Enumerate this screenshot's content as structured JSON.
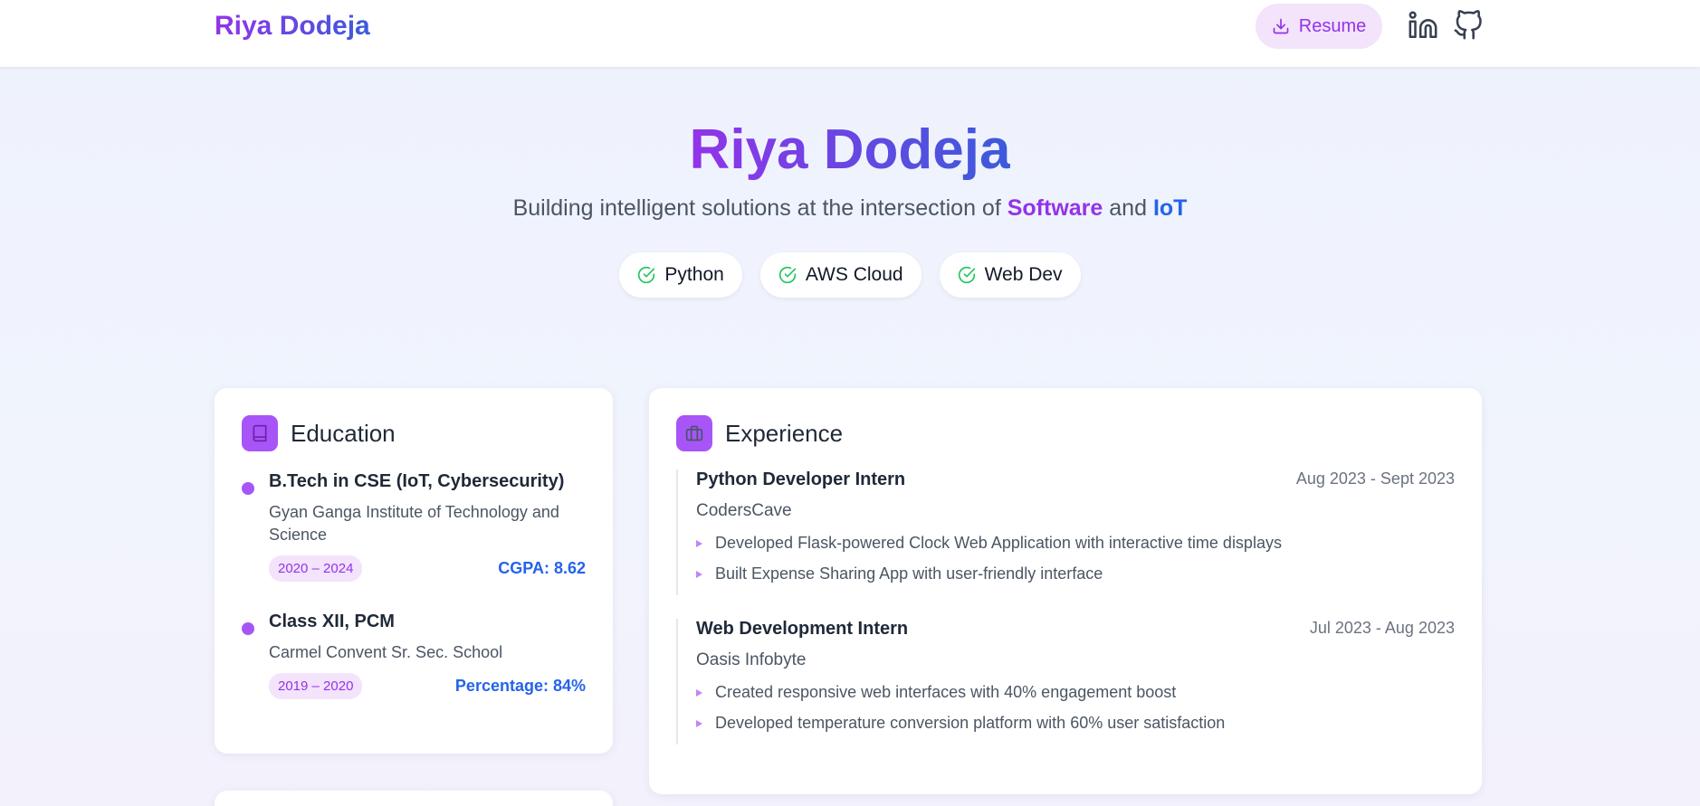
{
  "nav": {
    "brand": "Riya Dodeja",
    "resume_label": "Resume",
    "icons": [
      "download-icon",
      "linkedin-icon",
      "github-icon"
    ]
  },
  "hero": {
    "name": "Riya Dodeja",
    "tagline_prefix": "Building intelligent solutions at the intersection of ",
    "tagline_software": "Software",
    "tagline_and": " and ",
    "tagline_iot": "IoT",
    "skills": [
      "Python",
      "AWS Cloud",
      "Web Dev"
    ]
  },
  "education": {
    "title": "Education",
    "items": [
      {
        "degree": "B.Tech in CSE (IoT, Cybersecurity)",
        "institution": "Gyan Ganga Institute of Technology and Science",
        "years": "2020 – 2024",
        "score": "CGPA: 8.62"
      },
      {
        "degree": "Class XII, PCM",
        "institution": "Carmel Convent Sr. Sec. School",
        "years": "2019 – 2020",
        "score": "Percentage: 84%"
      }
    ]
  },
  "experience": {
    "title": "Experience",
    "items": [
      {
        "role": "Python Developer Intern",
        "company": "CodersCave",
        "dates": "Aug 2023 - Sept 2023",
        "points": [
          "Developed Flask-powered Clock Web Application with interactive time displays",
          "Built Expense Sharing App with user-friendly interface"
        ]
      },
      {
        "role": "Web Development Intern",
        "company": "Oasis Infobyte",
        "dates": "Jul 2023 - Aug 2023",
        "points": [
          "Created responsive web interfaces with 40% engagement boost",
          "Developed temperature conversion platform with 60% user satisfaction"
        ]
      }
    ]
  },
  "colors": {
    "accent_purple": "#9333ea",
    "accent_blue": "#2563eb",
    "check_green": "#22c55e"
  }
}
